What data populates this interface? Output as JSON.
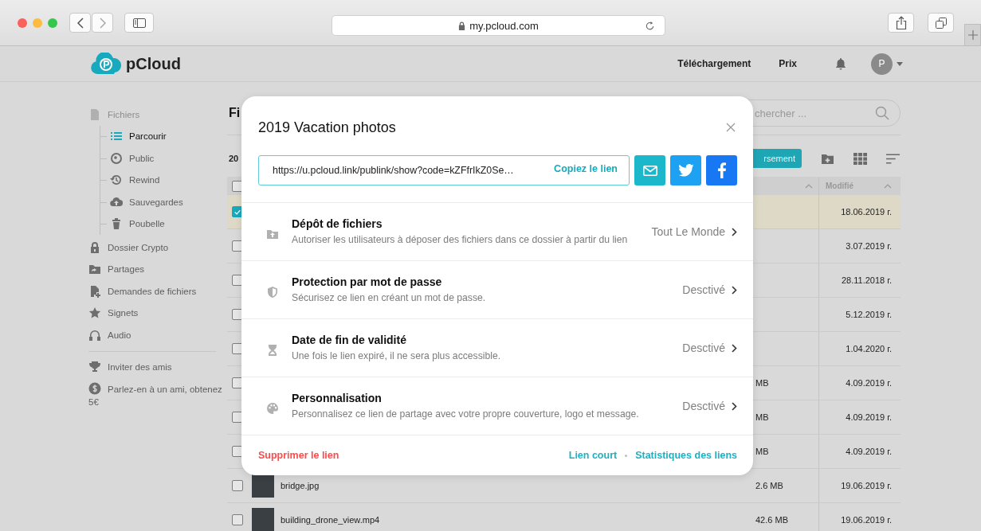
{
  "browser": {
    "url": "my.pcloud.com"
  },
  "header": {
    "brand": "pCloud",
    "nav": [
      "Téléchargement",
      "Prix"
    ],
    "avatar": "P"
  },
  "sidebar": {
    "items": [
      {
        "label": "Fichiers",
        "children": [
          {
            "label": "Parcourir",
            "selected": true
          },
          {
            "label": "Public",
            "selected": false
          },
          {
            "label": "Rewind",
            "selected": false
          },
          {
            "label": "Sauvegardes",
            "selected": false
          },
          {
            "label": "Poubelle",
            "selected": false
          }
        ]
      },
      {
        "label": "Dossier Crypto",
        "selected": false
      },
      {
        "label": "Partages",
        "selected": false
      },
      {
        "label": "Demandes de fichiers",
        "selected": false
      },
      {
        "label": "Signets",
        "selected": false
      },
      {
        "label": "Audio",
        "selected": false
      }
    ],
    "extras": [
      "Inviter des amis",
      "Parlez-en à un ami, obtenez 5€"
    ]
  },
  "main": {
    "title": "Fi",
    "search": {
      "placeholder": "chercher ..."
    },
    "count": "20",
    "upload_button": "rsement",
    "table": {
      "columns": [
        {
          "label": "Modifié"
        }
      ],
      "select_all": {
        "checked": false
      },
      "rows": [
        {
          "checked": true,
          "selected": true,
          "modified": "18.06.2019 г."
        },
        {
          "checked": false,
          "selected": false,
          "modified": "3.07.2019 г."
        },
        {
          "checked": false,
          "selected": false,
          "modified": "28.11.2018 г."
        },
        {
          "checked": false,
          "selected": false,
          "modified": "5.12.2019 г."
        },
        {
          "checked": false,
          "selected": false,
          "modified": "1.04.2020 г."
        },
        {
          "checked": false,
          "selected": false,
          "size": "MB",
          "modified": "4.09.2019 г."
        },
        {
          "checked": false,
          "selected": false,
          "size": "MB",
          "modified": "4.09.2019 г."
        },
        {
          "checked": false,
          "selected": false,
          "size": "MB",
          "modified": "4.09.2019 г."
        },
        {
          "checked": false,
          "selected": false,
          "name": "bridge.jpg",
          "size": "2.6 MB",
          "modified": "19.06.2019 г."
        },
        {
          "checked": false,
          "selected": false,
          "name": "building_drone_view.mp4",
          "size": "42.6 MB",
          "modified": "19.06.2019 г."
        }
      ]
    }
  },
  "modal": {
    "title": "2019 Vacation photos",
    "link": {
      "value": "https://u.pcloud.link/publink/show?code=kZFfrIkZ0Se…",
      "copy": "Copiez le lien"
    },
    "settings": [
      {
        "title": "Dépôt de fichiers",
        "description": "Autoriser les utilisateurs à déposer des fichiers dans ce dossier à partir du lien",
        "value": "Tout Le Monde"
      },
      {
        "title": "Protection par mot de passe",
        "description": "Sécurisez ce lien en créant un mot de passe.",
        "value": "Desctivé"
      },
      {
        "title": "Date de fin de validité",
        "description": "Une fois le lien expiré, il ne sera plus accessible.",
        "value": "Desctivé"
      },
      {
        "title": "Personnalisation",
        "description": "Personnalisez ce lien de partage avec votre propre couverture, logo et message.",
        "value": "Desctivé"
      }
    ],
    "delete": "Supprimer le lien",
    "links": [
      "Lien court",
      "Statistiques des liens"
    ]
  }
}
